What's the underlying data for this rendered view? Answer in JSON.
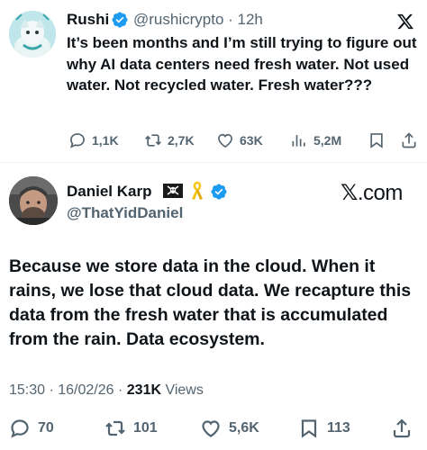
{
  "quoted_tweet": {
    "author_name": "Rushi",
    "handle_time": "@rushicrypto · 12h",
    "text": "It’s been months and I’m still trying to figure out why AI data centers need fresh water. Not used water. Not recycled water. Fresh water???",
    "replies": "1,1K",
    "reposts": "2,7K",
    "likes": "63K",
    "views": "5,2M"
  },
  "main_tweet": {
    "author_name": "Daniel Karp",
    "handle": "@ThatYidDaniel",
    "brand_prefix": "𝕏",
    "brand_suffix": ".com",
    "text": "Because we store data in the cloud. When it rains, we lose that cloud data. We recapture this data from the fresh water that is accumulated from the rain. Data ecosystem.",
    "timestamp": "15:30 · 16/02/26 · ",
    "views_count": "231K",
    "views_label": " Views",
    "replies": "70",
    "reposts": "101",
    "likes": "5,6K",
    "bookmarks": "113"
  },
  "colors": {
    "text": "#0f1419",
    "secondary": "#536471",
    "verified": "#1d9bf0",
    "divider": "#eff3f4"
  },
  "icons": [
    "verified-badge-icon",
    "x-logo-icon",
    "reply-icon",
    "repost-icon",
    "like-icon",
    "views-icon",
    "bookmark-icon",
    "share-icon",
    "pirate-flag-icon",
    "yellow-ribbon-icon"
  ]
}
